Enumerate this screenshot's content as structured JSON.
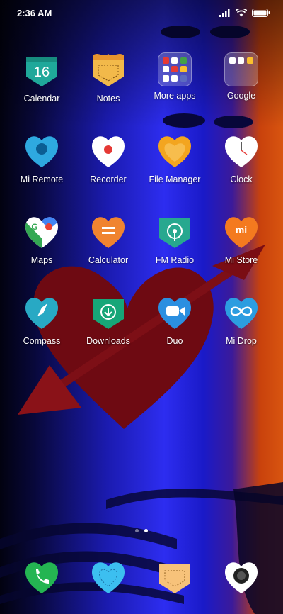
{
  "status": {
    "time": "2:36 AM"
  },
  "apps": [
    {
      "label": "Calendar",
      "date_number": "16"
    },
    {
      "label": "Notes"
    },
    {
      "label": "More apps"
    },
    {
      "label": "Google"
    },
    {
      "label": "Mi Remote"
    },
    {
      "label": "Recorder"
    },
    {
      "label": "File Manager"
    },
    {
      "label": "Clock"
    },
    {
      "label": "Maps",
      "glyph": "G"
    },
    {
      "label": "Calculator"
    },
    {
      "label": "FM Radio"
    },
    {
      "label": "Mi Store",
      "glyph": "mi"
    },
    {
      "label": "Compass"
    },
    {
      "label": "Downloads"
    },
    {
      "label": "Duo"
    },
    {
      "label": "Mi Drop"
    }
  ],
  "pager": {
    "count": 2,
    "active_index": 1
  },
  "dock": [
    "phone-icon",
    "messages-icon",
    "browser-icon",
    "camera-icon"
  ],
  "colors": {
    "calendar": "#1fa89a",
    "notes": "#f2b94a",
    "mi_remote": "#2ea9e0",
    "recorder": "#ffffff",
    "file_manager": "#f3a51f",
    "clock": "#ffffff",
    "maps": "#ffffff",
    "calculator": "#f08430",
    "fm_radio": "#27a88f",
    "mi_store": "#f47a1f",
    "compass": "#28a9c4",
    "downloads": "#17a678",
    "duo": "#2b8fe0",
    "mi_drop": "#2c9de0",
    "phone": "#24b552",
    "messages": "#3cbff0",
    "browser": "#f7c27a",
    "camera": "#ffffff"
  }
}
